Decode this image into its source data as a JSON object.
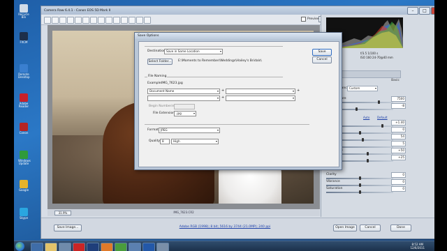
{
  "app": {
    "title": "Camera Raw 6.4.1  -  Canon EOS 5D Mark II"
  },
  "preview": {
    "checkbox_label": "Preview",
    "checked": true,
    "zoom": "31.9%",
    "filename": "IMG_7623.CR2"
  },
  "statusbar": {
    "save_label": "Save Image...",
    "workflow_link": "Adobe RGB (1998); 8 bit; 5616 by 3744 (21.0MP); 240 ppi",
    "open_label": "Open Image",
    "cancel_label": "Cancel",
    "done_label": "Done"
  },
  "camera_info": {
    "line1": "f/3.5    1/100 s",
    "line2": "ISO 160    24-70@40 mm"
  },
  "panel": {
    "section_title": "Basic",
    "white_balance_label": "White Balance:",
    "white_balance_value": "Custom",
    "auto_link": "Auto",
    "default_link": "Default",
    "controls": [
      {
        "label": "Temperature",
        "value": "7500"
      },
      {
        "label": "Tint",
        "value": "-8"
      },
      {
        "label": "Exposure",
        "value": "+1.40"
      },
      {
        "label": "Recovery",
        "value": "0"
      },
      {
        "label": "Fill Light",
        "value": "54"
      },
      {
        "label": "Blacks",
        "value": "5"
      },
      {
        "label": "Brightness",
        "value": "+50"
      },
      {
        "label": "Contrast",
        "value": "+25"
      },
      {
        "label": "Clarity",
        "value": "0"
      },
      {
        "label": "Vibrance",
        "value": "0"
      },
      {
        "label": "Saturation",
        "value": "0"
      }
    ],
    "levels": [
      0.8,
      0.45,
      0.85,
      0.5,
      0.55,
      0.12,
      0.62,
      0.62,
      0.5,
      0.5,
      0.5
    ]
  },
  "dialog": {
    "title": "Save Options",
    "save_label": "Save",
    "cancel_label": "Cancel",
    "destination_label": "Destination:",
    "destination_value": "Save in Same Location",
    "select_folder_label": "Select Folder...",
    "folder_path": "E:\\Moments to Remember\\Weddings\\Hailey's Bridals\\",
    "file_naming_label": "File Naming",
    "example_label": "Example:",
    "example_value": "IMG_7623.jpg",
    "naming_field1": "Document Name",
    "naming_field2": "",
    "naming_field3": "",
    "naming_field4": "",
    "begin_numbering_label": "Begin Numbering:",
    "file_extension_label": "File Extension:",
    "file_extension_value": ".jpg",
    "format_label": "Format:",
    "format_value": "JPEG",
    "quality_label": "Quality:",
    "quality_number": "8",
    "quality_value": "High"
  },
  "taskbar": {
    "time": "8:52 AM",
    "date": "12/6/2011"
  },
  "desktop_icons": [
    {
      "label": "Recycle Bin"
    },
    {
      "label": "FXCM"
    },
    {
      "label": "Remote Desktop"
    },
    {
      "label": "Adobe Reader"
    },
    {
      "label": "Canon"
    },
    {
      "label": "Windows Update"
    },
    {
      "label": "Google"
    },
    {
      "label": "Skype"
    }
  ]
}
